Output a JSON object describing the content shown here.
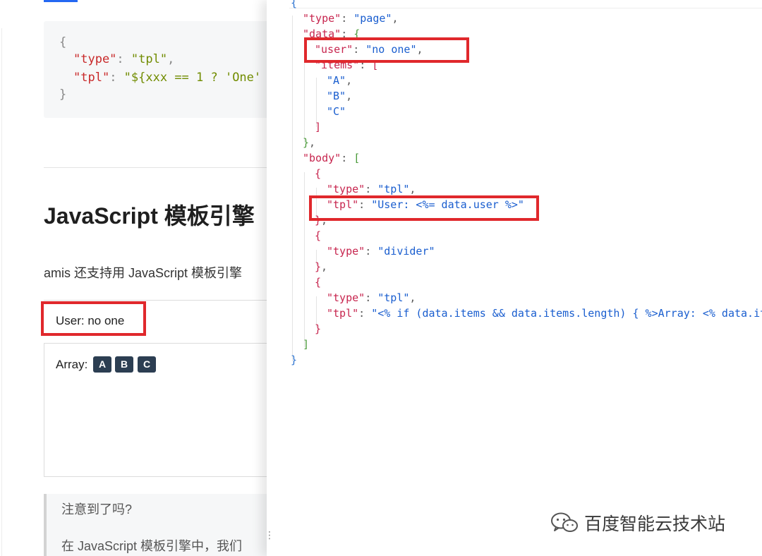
{
  "doc": {
    "code_example": {
      "open_brace": "{",
      "type_key": "\"type\"",
      "type_value": "\"tpl\"",
      "tpl_key": "\"tpl\"",
      "tpl_value": "\"${xxx == 1 ? 'One'",
      "close_brace": "}"
    },
    "heading": "JavaScript 模板引擎",
    "paragraph": "amis 还支持用 JavaScript 模板引擎",
    "preview": {
      "user_text": "User: no one",
      "array_label": "Array:",
      "chips": [
        "A",
        "B",
        "C"
      ]
    },
    "notice": {
      "title": "注意到了吗?",
      "text": "在 JavaScript 模板引擎中，我们"
    }
  },
  "json_panel": {
    "lines": [
      {
        "parts": [
          {
            "t": "{",
            "c": "b"
          }
        ]
      },
      {
        "parts": [
          {
            "t": "\"type\"",
            "c": "k"
          },
          {
            "t": ": ",
            "c": "p"
          },
          {
            "t": "\"page\"",
            "c": "s"
          },
          {
            "t": ",",
            "c": "p"
          }
        ]
      },
      {
        "parts": [
          {
            "t": "\"data\"",
            "c": "k"
          },
          {
            "t": ": ",
            "c": "p"
          },
          {
            "t": "{",
            "c": "g"
          }
        ]
      },
      {
        "parts": [
          {
            "t": "\"user\"",
            "c": "k"
          },
          {
            "t": ": ",
            "c": "p"
          },
          {
            "t": "\"no one\"",
            "c": "s"
          },
          {
            "t": ",",
            "c": "p"
          }
        ]
      },
      {
        "parts": [
          {
            "t": "\"items\"",
            "c": "k"
          },
          {
            "t": ": ",
            "c": "p"
          },
          {
            "t": "[",
            "c": "k"
          }
        ]
      },
      {
        "parts": [
          {
            "t": "\"A\"",
            "c": "s"
          },
          {
            "t": ",",
            "c": "p"
          }
        ]
      },
      {
        "parts": [
          {
            "t": "\"B\"",
            "c": "s"
          },
          {
            "t": ",",
            "c": "p"
          }
        ]
      },
      {
        "parts": [
          {
            "t": "\"C\"",
            "c": "s"
          }
        ]
      },
      {
        "parts": [
          {
            "t": "]",
            "c": "k"
          }
        ]
      },
      {
        "parts": [
          {
            "t": "}",
            "c": "g"
          },
          {
            "t": ",",
            "c": "p"
          }
        ]
      },
      {
        "parts": [
          {
            "t": "\"body\"",
            "c": "k"
          },
          {
            "t": ": ",
            "c": "p"
          },
          {
            "t": "[",
            "c": "g"
          }
        ]
      },
      {
        "parts": [
          {
            "t": "{",
            "c": "k"
          }
        ]
      },
      {
        "parts": [
          {
            "t": "\"type\"",
            "c": "k"
          },
          {
            "t": ": ",
            "c": "p"
          },
          {
            "t": "\"tpl\"",
            "c": "s"
          },
          {
            "t": ",",
            "c": "p"
          }
        ]
      },
      {
        "parts": [
          {
            "t": "\"tpl\"",
            "c": "k"
          },
          {
            "t": ": ",
            "c": "p"
          },
          {
            "t": "\"User: <%= data.user %>\"",
            "c": "s"
          }
        ]
      },
      {
        "parts": [
          {
            "t": "}",
            "c": "k"
          },
          {
            "t": ",",
            "c": "p"
          }
        ]
      },
      {
        "parts": [
          {
            "t": "{",
            "c": "k"
          }
        ]
      },
      {
        "parts": [
          {
            "t": "\"type\"",
            "c": "k"
          },
          {
            "t": ": ",
            "c": "p"
          },
          {
            "t": "\"divider\"",
            "c": "s"
          }
        ]
      },
      {
        "parts": [
          {
            "t": "}",
            "c": "k"
          },
          {
            "t": ",",
            "c": "p"
          }
        ]
      },
      {
        "parts": [
          {
            "t": "{",
            "c": "k"
          }
        ]
      },
      {
        "parts": [
          {
            "t": "\"type\"",
            "c": "k"
          },
          {
            "t": ": ",
            "c": "p"
          },
          {
            "t": "\"tpl\"",
            "c": "s"
          },
          {
            "t": ",",
            "c": "p"
          }
        ]
      },
      {
        "parts": [
          {
            "t": "\"tpl\"",
            "c": "k"
          },
          {
            "t": ": ",
            "c": "p"
          },
          {
            "t": "\"<% if (data.items && data.items.length) { %>Array: <% data.it",
            "c": "s"
          }
        ]
      },
      {
        "parts": [
          {
            "t": "}",
            "c": "k"
          }
        ]
      },
      {
        "parts": [
          {
            "t": "]",
            "c": "g"
          }
        ]
      },
      {
        "parts": [
          {
            "t": "}",
            "c": "b"
          }
        ]
      }
    ]
  },
  "watermark": {
    "icon": "wechat-icon",
    "text": "百度智能云技术站"
  },
  "colors": {
    "highlight": "#e0282c",
    "chip_bg": "#2c3e52",
    "json_key": "#c7254e",
    "json_string": "#1a5ecf"
  }
}
